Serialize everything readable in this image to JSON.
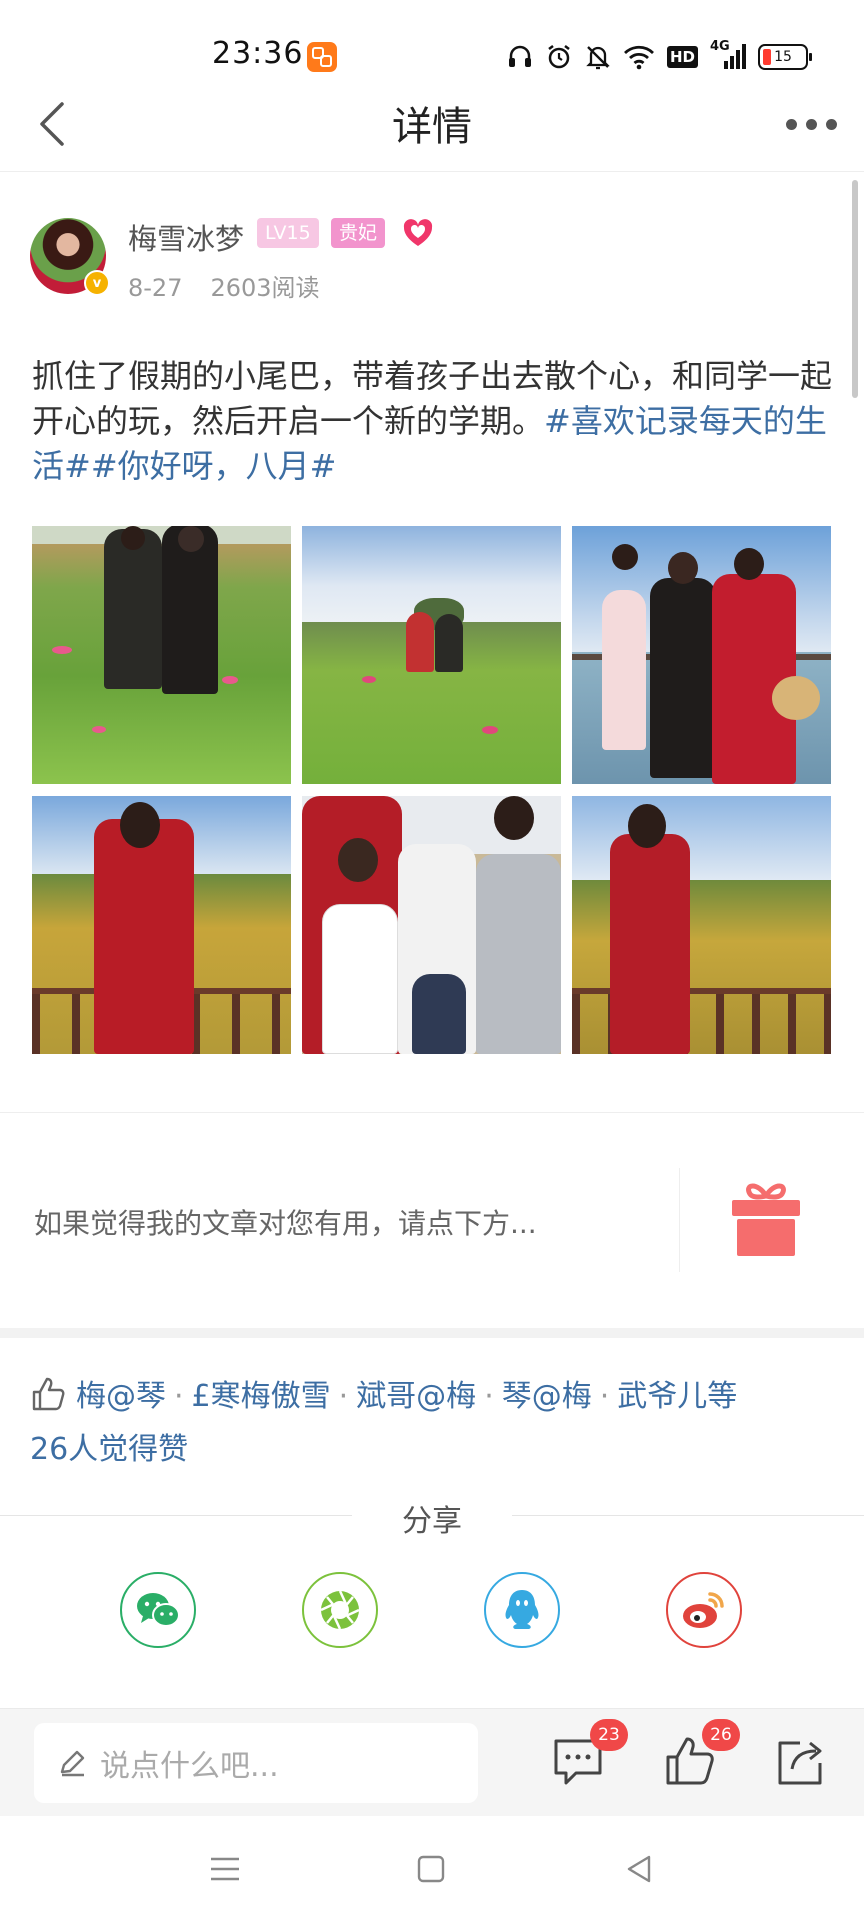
{
  "status_bar": {
    "time": "23:36",
    "network": "4G",
    "hd": "HD",
    "battery": "15",
    "icons": [
      "app-icon",
      "headphones-icon",
      "alarm-icon",
      "mute-icon",
      "wifi-icon",
      "hd-icon",
      "signal-icon",
      "battery-icon"
    ]
  },
  "header": {
    "title": "详情",
    "back_icon": "chevron-left-icon",
    "more_icon": "more-dots-icon"
  },
  "author": {
    "name": "梅雪冰梦",
    "level": "LV15",
    "vip": "贵妃",
    "date": "8-27",
    "reads": "2603阅读",
    "badge_icon": "verified-icon",
    "heart_icon": "heart-icon"
  },
  "post": {
    "text_plain": "抓住了假期的小尾巴，带着孩子出去散个心，和同学一起开心的玩，然后开启一个新的学期。",
    "hashtags": "#喜欢记录每天的生活##你好呀，八月#",
    "photos": [
      "photo-flower-field-two-women",
      "photo-flower-field-sky",
      "photo-lake-woman-child",
      "photo-sunflower-red-dress",
      "photo-three-boys",
      "photo-sunflower-railing"
    ]
  },
  "reward": {
    "prompt": "如果觉得我的文章对您有用，请点下方...",
    "icon": "gift-icon"
  },
  "likes": {
    "names": [
      "梅@琴",
      "£寒梅傲雪",
      "斌哥@梅",
      "琴@梅",
      "武爷儿等"
    ],
    "summary": "26人觉得赞",
    "icon": "thumbs-up-icon"
  },
  "share": {
    "label": "分享",
    "targets": [
      "wechat-icon",
      "moments-icon",
      "qq-icon",
      "weibo-icon"
    ]
  },
  "comment_bar": {
    "placeholder": "说点什么吧...",
    "comment_count": "23",
    "like_count": "26"
  },
  "colors": {
    "link": "#3d6ea3",
    "badge_red": "#f04848",
    "wechat": "#2aae67",
    "moments": "#7cc23c",
    "qq": "#36a9e1",
    "weibo": "#e0433c",
    "gift": "#f56d6d"
  }
}
